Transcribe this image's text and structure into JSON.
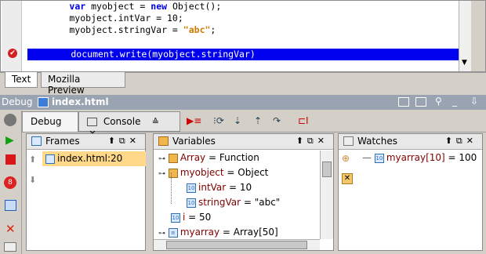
{
  "editor": {
    "lines": [
      {
        "pre": "        ",
        "kw": "var",
        "rest": " myobject = ",
        "kw2": "new",
        "rest2": " Object();"
      },
      {
        "plain": "        myobject.intVar = 10;"
      },
      {
        "pre": "        myobject.stringVar = ",
        "str": "\"abc\"",
        "post": ";"
      }
    ],
    "current_line": "        document.write(myobject.stringVar)",
    "tabs": [
      "Text",
      "Mozilla Preview"
    ]
  },
  "debug_window": {
    "title": "Debug",
    "file": "index.html"
  },
  "toolbar": {
    "tab_debug": "Debug",
    "tab_console": "Console"
  },
  "frames": {
    "title": "Frames",
    "items": [
      "index.html:20"
    ]
  },
  "variables": {
    "title": "Variables",
    "items": [
      {
        "name": "Array",
        "value": " = Function"
      },
      {
        "name": "myobject",
        "value": " = Object"
      },
      {
        "name": "intVar",
        "value": " = 10"
      },
      {
        "name": "stringVar",
        "value": " = \"abc\""
      },
      {
        "name": "i",
        "value": " = 50"
      },
      {
        "name": "myarray",
        "value": " = Array[50]"
      }
    ]
  },
  "watches": {
    "title": "Watches",
    "items": [
      {
        "name": "myarray[10]",
        "value": " = 100"
      }
    ]
  },
  "colors": {
    "highlight": "#0000ee",
    "keyword": "#0000e6",
    "string": "#ce7b00"
  }
}
